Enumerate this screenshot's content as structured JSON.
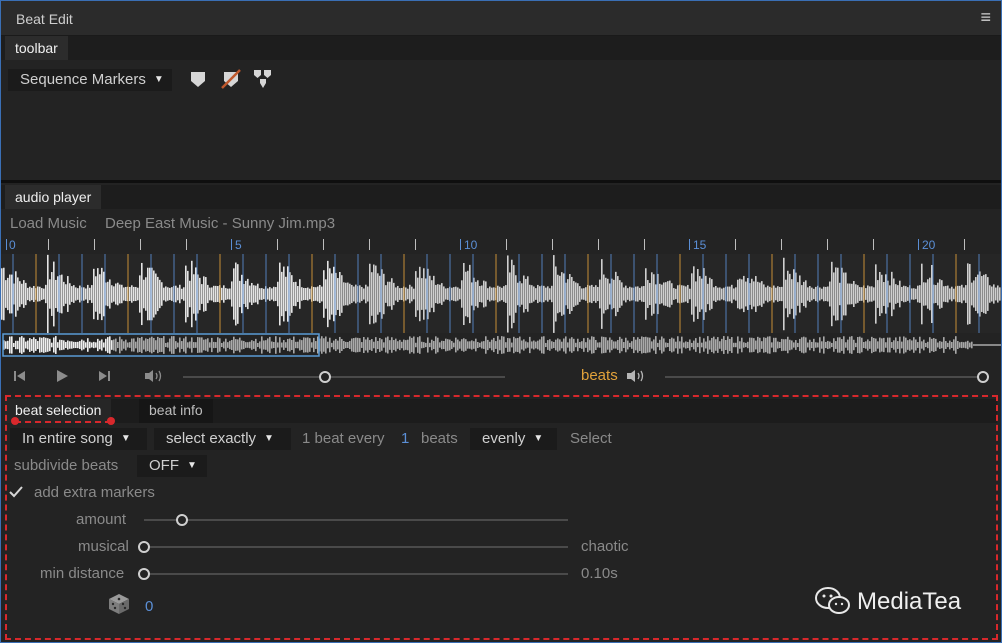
{
  "window": {
    "title": "Beat Edit",
    "menu_icon": "hamburger-icon"
  },
  "toolbar_panel": {
    "tab": "toolbar",
    "marker_dropdown": "Sequence Markers",
    "icons": [
      "marker-icon",
      "remove-marker-icon",
      "split-marker-icon"
    ]
  },
  "audio_panel": {
    "tab": "audio player",
    "load_music": "Load Music",
    "file_name": "Deep East Music - Sunny Jim.mp3",
    "ruler_labels": [
      "0",
      "5",
      "10",
      "15",
      "20"
    ],
    "beats_label": "beats",
    "playback_position": 0.44,
    "beats_volume": 1.0,
    "accent": "#e2a23a",
    "beat_line_color": "#5b8fd6"
  },
  "beat_panel": {
    "tabs": [
      "beat selection",
      "beat info"
    ],
    "range_dropdown": "In entire song",
    "mode_dropdown": "select exactly",
    "every_prefix": "1 beat every",
    "every_value": "1",
    "every_suffix": "beats",
    "distribution_dropdown": "evenly",
    "select_label": "Select",
    "subdivide_label": "subdivide beats",
    "subdivide_value": "OFF",
    "extra_markers_label": "add extra markers",
    "extra_markers_checked": true,
    "amount_label": "amount",
    "amount_value": 0.09,
    "musical_label": "musical",
    "musical_value": 0.0,
    "chaotic_label": "chaotic",
    "min_distance_label": "min distance",
    "min_distance_text": "0.10s",
    "min_distance_value": 0.0,
    "dice_count": "0"
  },
  "watermark": {
    "text": "MediaTea"
  },
  "colors": {
    "highlight": "#d8282c",
    "selection": "#5b9bd5"
  }
}
